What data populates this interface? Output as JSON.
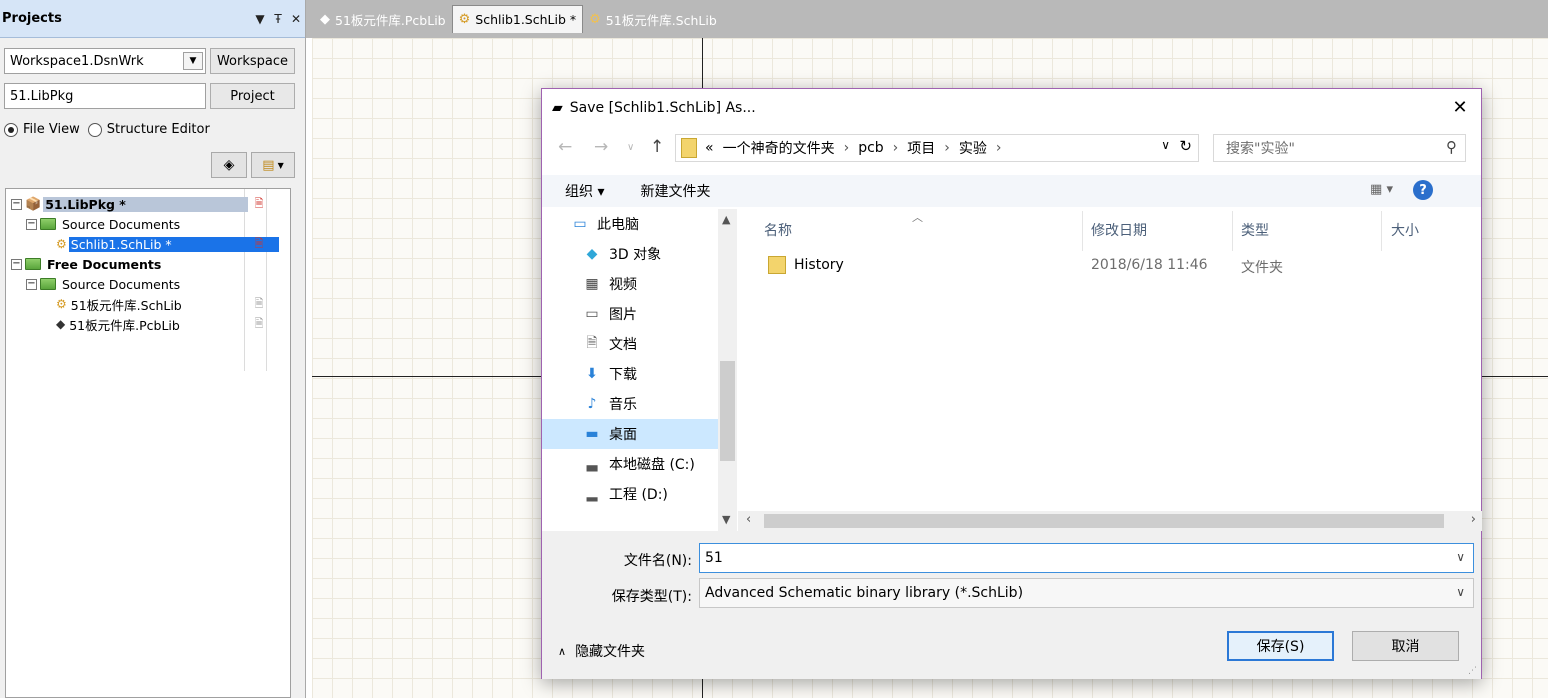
{
  "projects_panel": {
    "title": "Projects",
    "workspace_combo": "Workspace1.DsnWrk",
    "workspace_button": "Workspace",
    "project_field": "51.LibPkg",
    "project_button": "Project",
    "view_options": {
      "file_view": "File View",
      "structure_editor": "Structure Editor"
    },
    "tree": {
      "root": "51.LibPkg *",
      "source_documents": "Source Documents",
      "schlib": "Schlib1.SchLib *",
      "free_documents": "Free Documents",
      "free_source_documents": "Source Documents",
      "free_schlib": "51板元件库.SchLib",
      "free_pcblib": "51板元件库.PcbLib"
    }
  },
  "tabs": [
    {
      "label": "51板元件库.PcbLib"
    },
    {
      "label": "Schlib1.SchLib *"
    },
    {
      "label": "51板元件库.SchLib"
    }
  ],
  "dialog": {
    "title": "Save [Schlib1.SchLib] As...",
    "breadcrumb": [
      "«",
      "一个神奇的文件夹",
      "pcb",
      "项目",
      "实验"
    ],
    "search_placeholder": "搜索\"实验\"",
    "toolbar": {
      "organize": "组织 ▾",
      "new_folder": "新建文件夹"
    },
    "nav_items": [
      {
        "label": "此电脑"
      },
      {
        "label": "3D 对象"
      },
      {
        "label": "视频"
      },
      {
        "label": "图片"
      },
      {
        "label": "文档"
      },
      {
        "label": "下载"
      },
      {
        "label": "音乐"
      },
      {
        "label": "桌面"
      },
      {
        "label": "本地磁盘 (C:)"
      },
      {
        "label": "工程 (D:)"
      }
    ],
    "columns": {
      "name": "名称",
      "date": "修改日期",
      "type": "类型",
      "size": "大小"
    },
    "files": [
      {
        "name": "History",
        "date": "2018/6/18 11:46",
        "type": "文件夹"
      }
    ],
    "filename_label": "文件名(N):",
    "filename_value": "51",
    "filetype_label": "保存类型(T):",
    "filetype_value": "Advanced Schematic binary library (*.SchLib)",
    "hide_folders": "隐藏文件夹",
    "save_button": "保存(S)",
    "cancel_button": "取消"
  }
}
